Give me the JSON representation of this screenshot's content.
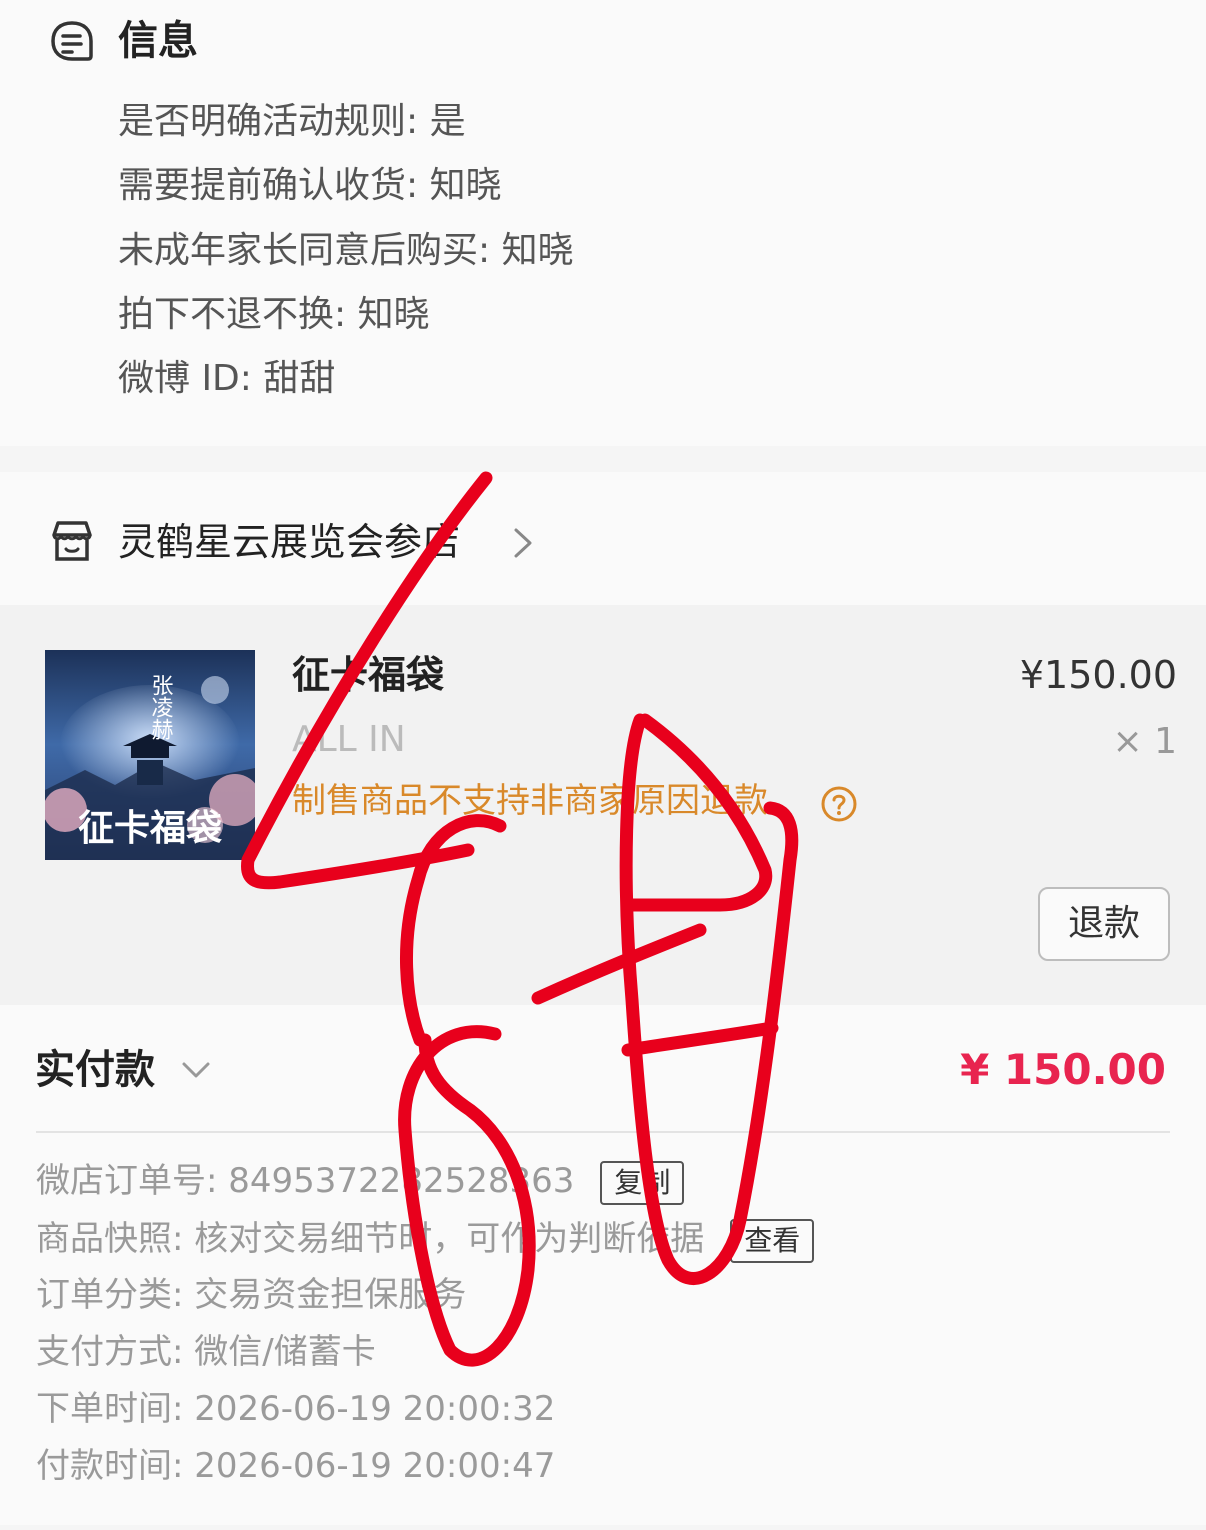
{
  "info": {
    "title": "信息",
    "icon": "chat-bubble-icon",
    "rows": [
      "是否明确活动规则: 是",
      "需要提前确认收货: 知晓",
      "未成年家长同意后购买: 知晓",
      "拍下不退不换: 知晓",
      "微博 ID: 甜甜"
    ]
  },
  "shop": {
    "name": "灵鹤星云展览会参店",
    "icon": "store-icon"
  },
  "item": {
    "title": "征卡福袋",
    "sku": "ALL IN",
    "notice": "制售商品不支持非商家原因退款",
    "price": "¥150.00",
    "quantity": "× 1",
    "refund_label": "退款",
    "thumbnail_text": "征卡福袋",
    "thumbnail_name": "张凌赫"
  },
  "payment": {
    "paid_label": "实付款",
    "paid_amount": "¥ 150.00",
    "order_no": "微店订单号:  8495372282528363",
    "copy_label": "复制",
    "snapshot": "商品快照: 核对交易细节时，可作为判断依据",
    "view_label": "查看",
    "category": "订单分类:  交易资金担保服务",
    "method": "支付方式:  微信/储蓄卡",
    "order_time": "下单时间:  2026-06-19 20:00:32",
    "pay_time": "付款时间:  2026-06-19 20:00:47"
  },
  "colors": {
    "accent_red": "#e8244f",
    "notice_orange": "#d9892a",
    "scribble_red": "#e8001c"
  }
}
